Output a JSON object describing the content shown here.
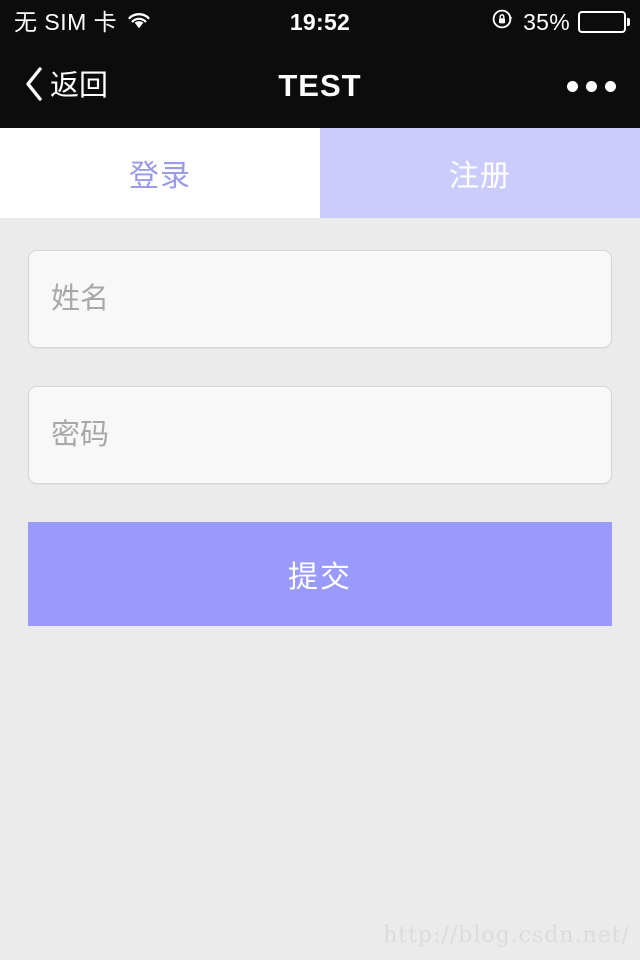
{
  "status_bar": {
    "carrier": "无 SIM 卡",
    "wifi_icon": "wifi-icon",
    "time": "19:52",
    "rotation_lock_icon": "rotation-lock-icon",
    "battery_percent": "35%",
    "battery_level": 35,
    "background": "#0c0c0c",
    "foreground": "#ffffff"
  },
  "nav_bar": {
    "back_icon": "chevron-left-icon",
    "back_label": "返回",
    "title": "TEST",
    "more_icon": "more-horizontal-icon",
    "background": "#0c0c0c"
  },
  "tabs": [
    {
      "label": "登录",
      "active": false,
      "background": "#ffffff",
      "color": "#9a9ae8"
    },
    {
      "label": "注册",
      "active": true,
      "background": "#cbcbfc",
      "color": "#ffffff"
    }
  ],
  "form": {
    "fields": [
      {
        "name": "name",
        "placeholder": "姓名",
        "value": "",
        "type": "text"
      },
      {
        "name": "password",
        "placeholder": "密码",
        "value": "",
        "type": "text"
      }
    ],
    "submit_label": "提交",
    "submit_color": "#9a9afd"
  },
  "watermark": {
    "text": "http://blog.csdn.net/"
  },
  "theme": {
    "page_background": "#ebebeb",
    "accent": "#9a9afd",
    "accent_light": "#cbcbfc",
    "field_background": "#f8f8f8",
    "field_border": "#d6d6d6",
    "placeholder_color": "#a8a8a8"
  }
}
